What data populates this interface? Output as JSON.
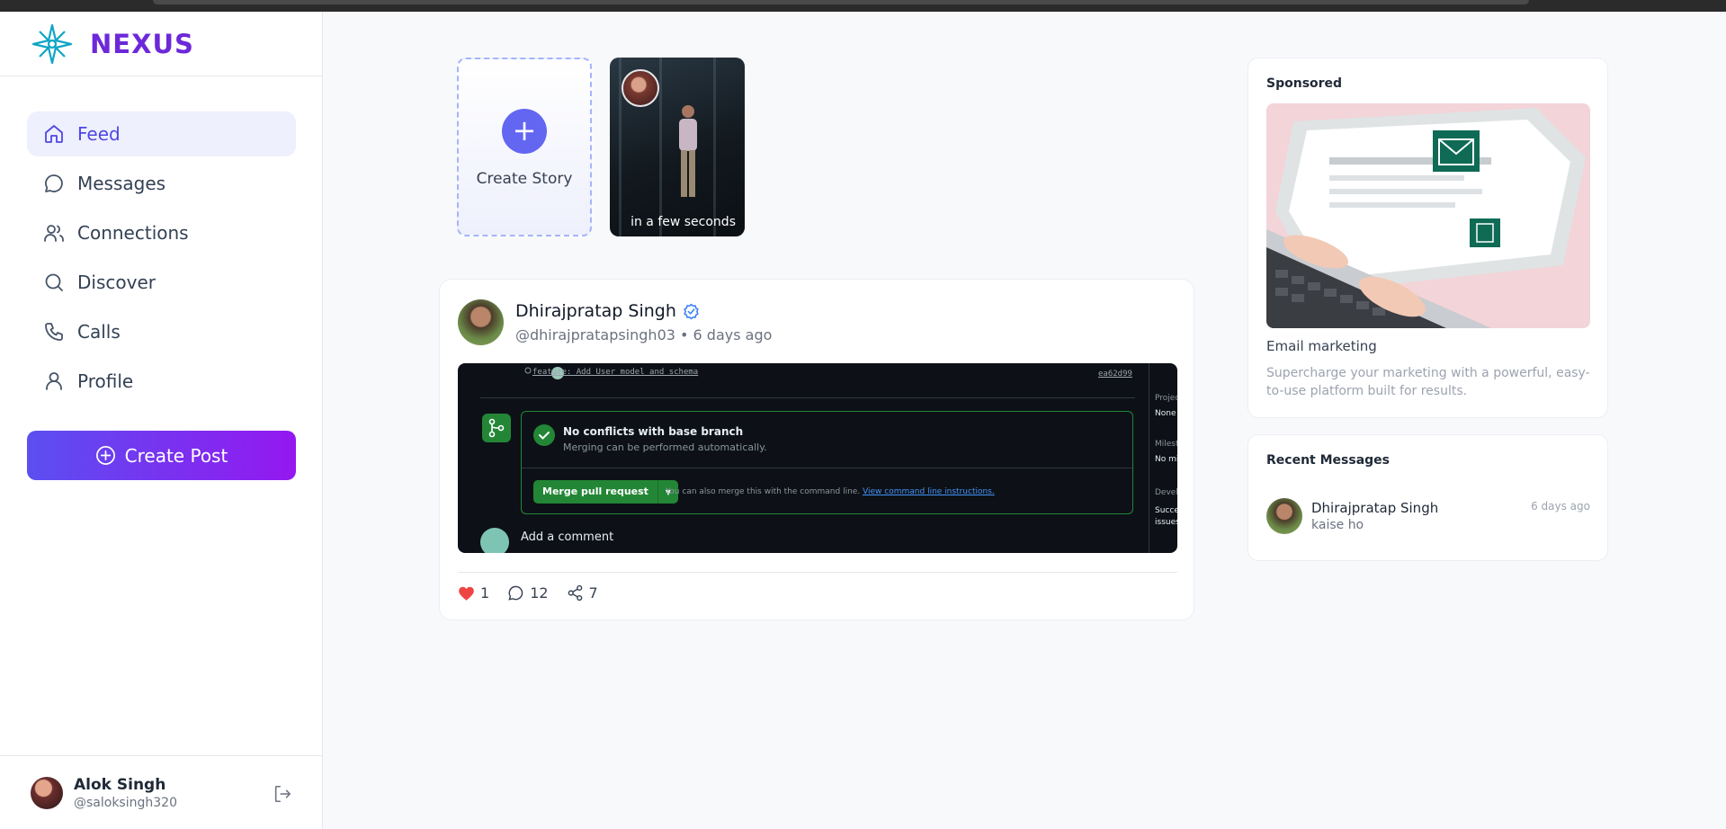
{
  "brand": {
    "name": "NEXUS"
  },
  "nav": {
    "items": [
      {
        "label": "Feed",
        "active": true
      },
      {
        "label": "Messages"
      },
      {
        "label": "Connections"
      },
      {
        "label": "Discover"
      },
      {
        "label": "Calls"
      },
      {
        "label": "Profile"
      }
    ],
    "create_post_label": "Create Post"
  },
  "current_user": {
    "name": "Alok Singh",
    "handle": "@saloksingh320"
  },
  "stories": {
    "create_label": "Create Story",
    "create_plus": "+",
    "items": [
      {
        "caption": "in a few seconds"
      }
    ]
  },
  "post": {
    "author": "Dhirajpratap Singh",
    "meta": "@dhirajpratapsingh03 • 6 days ago",
    "likes": "1",
    "comments": "12",
    "shares": "7",
    "image": {
      "commit_msg": "feature: Add User model and schema",
      "commit_hash": "ea62d99",
      "merge_title": "No conflicts with base branch",
      "merge_sub": "Merging can be performed automatically.",
      "merge_button": "Merge pull request",
      "merge_also": "You can also merge this with the command line.",
      "merge_link": "View command line instructions.",
      "comment_label": "Add a comment",
      "side_projects": "Project",
      "side_projects_value": "None y",
      "side_milestone": "Milesto",
      "side_milestone_value": "No mil",
      "side_dev": "Develo",
      "side_dev_value_1": "Succes",
      "side_dev_value_2": "issues."
    }
  },
  "sponsored": {
    "title": "Sponsored",
    "ad_title": "Email marketing",
    "ad_desc": "Supercharge your marketing with a powerful, easy-to-use platform built for results."
  },
  "recent_messages": {
    "title": "Recent Messages",
    "items": [
      {
        "name": "Dhirajpratap Singh",
        "text": "kaise ho",
        "time": "6 days ago"
      }
    ]
  },
  "colors": {
    "accent": "#4f46e5",
    "brand": "#6d28d9",
    "like": "#ef4444",
    "verified": "#3b82f6"
  }
}
